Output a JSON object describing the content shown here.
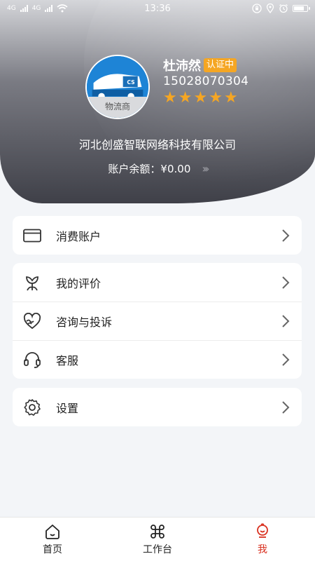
{
  "status_bar": {
    "signal_left": "4G",
    "signal_right": "4G",
    "time": "13:36"
  },
  "profile": {
    "name": "杜沛然",
    "badge": "认证中",
    "phone": "15028070304",
    "rating_stars": 5,
    "avatar_label": "物流商",
    "company": "河北创盛智联网络科技有限公司",
    "balance_label": "账户余额：",
    "balance_value": "¥0.00",
    "balance_arrow": "»"
  },
  "menu": {
    "group1": [
      {
        "label": "消费账户",
        "icon": "wallet-icon"
      }
    ],
    "group2": [
      {
        "label": "我的评价",
        "icon": "flower-icon"
      },
      {
        "label": "咨询与投诉",
        "icon": "heart-wave-icon"
      },
      {
        "label": "客服",
        "icon": "headset-icon"
      }
    ],
    "group3": [
      {
        "label": "设置",
        "icon": "gear-icon"
      }
    ]
  },
  "tabbar": {
    "items": [
      {
        "label": "首页",
        "icon": "home-icon",
        "active": false
      },
      {
        "label": "工作台",
        "icon": "command-icon",
        "active": false
      },
      {
        "label": "我",
        "icon": "person-icon",
        "active": true
      }
    ]
  },
  "colors": {
    "accent": "#d9301f",
    "star": "#f5a623",
    "badge": "#f5a623",
    "header_dark": "#3f4048"
  }
}
